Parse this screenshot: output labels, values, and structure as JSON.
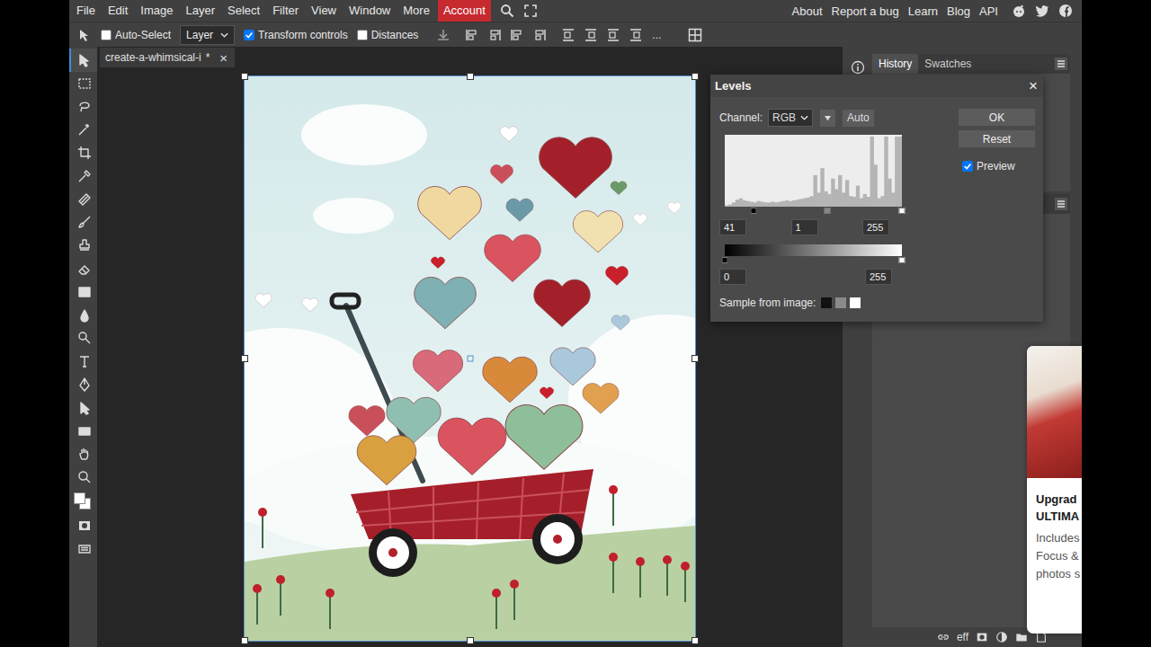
{
  "menu": {
    "items": [
      "File",
      "Edit",
      "Image",
      "Layer",
      "Select",
      "Filter",
      "View",
      "Window",
      "More"
    ],
    "account": "Account",
    "links": [
      "About",
      "Report a bug",
      "Learn",
      "Blog",
      "API"
    ]
  },
  "toolbar": {
    "auto_select": {
      "label": "Auto-Select",
      "checked": false
    },
    "layer_select": "Layer",
    "transform_controls": {
      "label": "Transform controls",
      "checked": true
    },
    "distances": {
      "label": "Distances",
      "checked": false
    },
    "more": "..."
  },
  "tools": [
    {
      "selected": true
    },
    {
      "selected": false
    },
    {
      "selected": false
    },
    {
      "selected": false
    },
    {
      "selected": false
    },
    {
      "selected": false
    },
    {
      "selected": false
    },
    {
      "selected": false
    },
    {
      "selected": false
    },
    {
      "selected": false
    },
    {
      "selected": false
    },
    {
      "selected": false
    },
    {
      "selected": false
    },
    {
      "selected": false
    },
    {
      "selected": false
    },
    {
      "selected": false
    },
    {
      "selected": false
    },
    {
      "selected": false
    },
    {
      "selected": false
    }
  ],
  "colors": {
    "foreground": "#ffffff",
    "background": "#ffffff"
  },
  "document_tab": {
    "title": "create-a-whimsical-i",
    "modified": "*",
    "close": "×"
  },
  "levels": {
    "title": "Levels",
    "close": "×",
    "channel_label": "Channel:",
    "channel": "RGB",
    "auto": "Auto",
    "histogram": [
      2,
      3,
      6,
      10,
      12,
      9,
      8,
      7,
      6,
      8,
      7,
      6,
      6,
      7,
      6,
      7,
      8,
      9,
      8,
      9,
      10,
      11,
      12,
      13,
      15,
      45,
      20,
      55,
      22,
      18,
      40,
      25,
      45,
      20,
      38,
      15,
      14,
      30,
      12,
      18,
      14,
      100,
      60,
      12,
      15,
      100,
      40,
      20,
      100,
      100
    ],
    "input_black": "41",
    "input_gamma": "1",
    "input_white": "255",
    "output_black": "0",
    "output_white": "255",
    "sample_label": "Sample from image:",
    "ok": "OK",
    "reset": "Reset",
    "preview": {
      "label": "Preview",
      "checked": true
    }
  },
  "panel": {
    "tabs": [
      {
        "label": "History",
        "selected": true
      },
      {
        "label": "Swatches",
        "selected": false
      }
    ]
  },
  "layers_footer": {
    "effects": "eff"
  },
  "ad": {
    "title_lines": [
      "Upgrad",
      "ULTIMA"
    ],
    "body_lines": [
      "Includes",
      "Focus &",
      "photos s"
    ]
  }
}
